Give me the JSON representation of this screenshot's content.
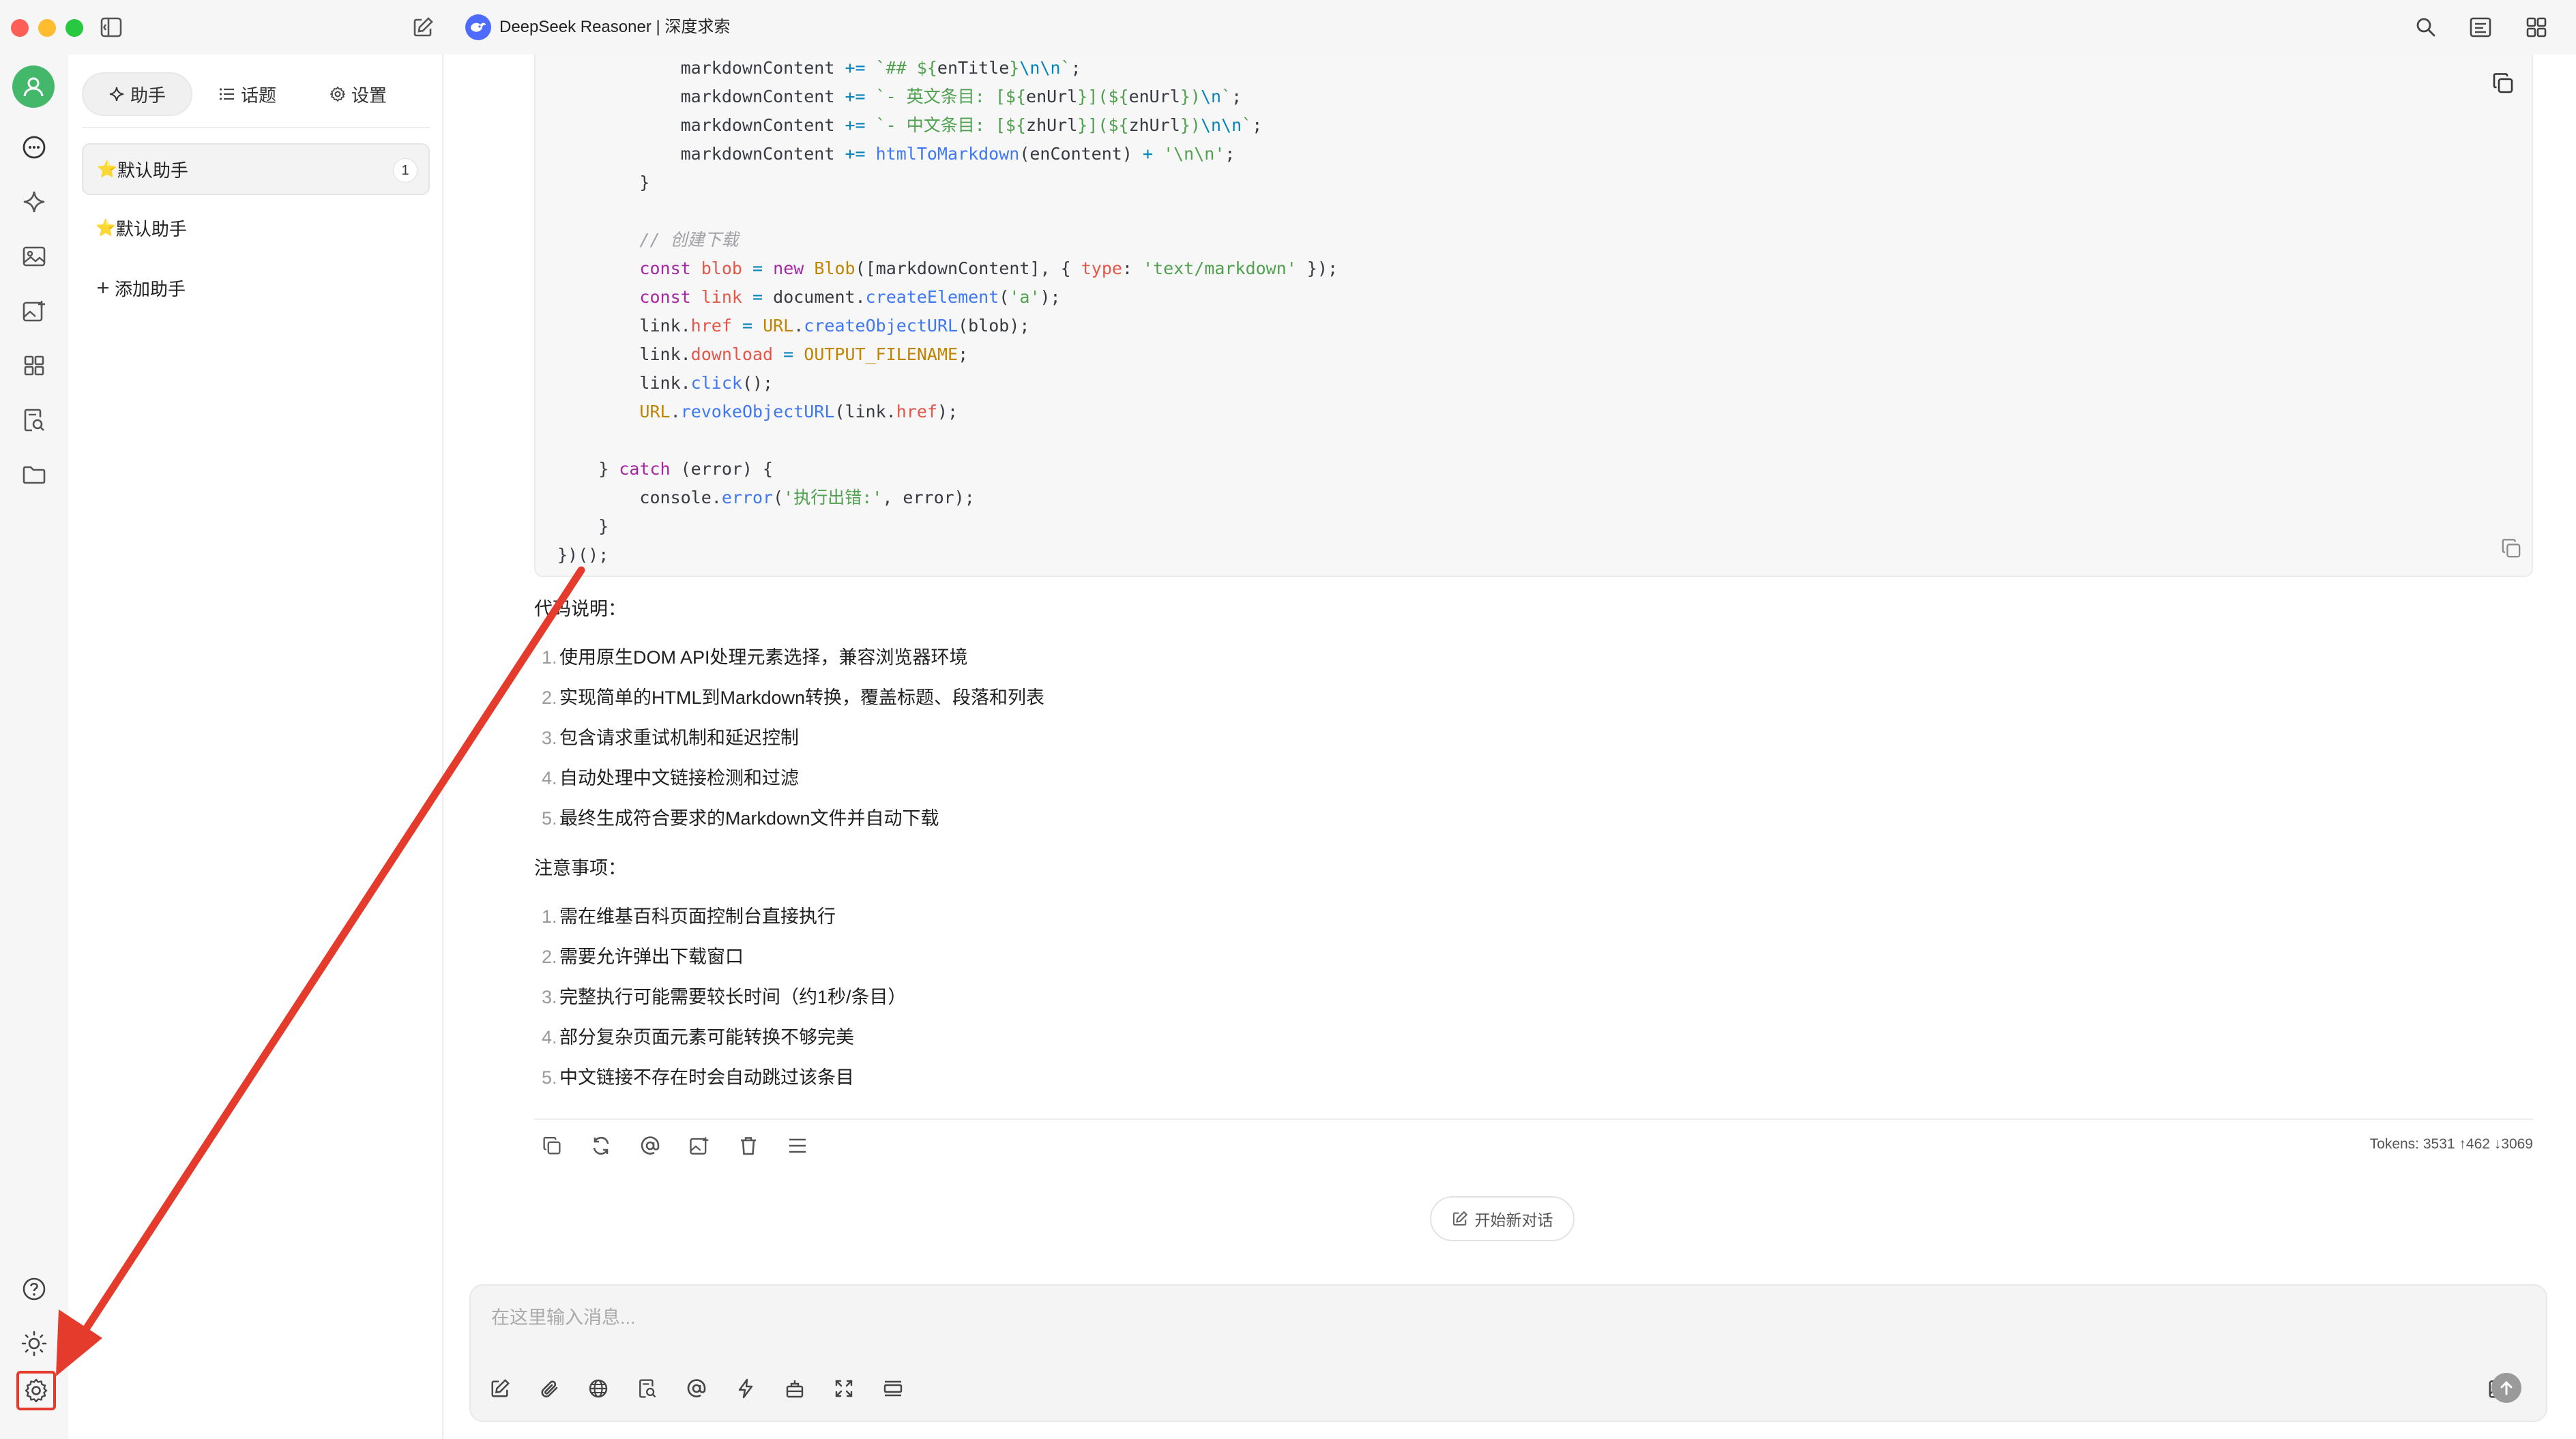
{
  "window": {
    "title": "DeepSeek Reasoner | 深度求索"
  },
  "sidebar": {
    "tabs": [
      {
        "label": "助手",
        "icon": "sparkle-icon"
      },
      {
        "label": "话题",
        "icon": "list-icon"
      },
      {
        "label": "设置",
        "icon": "gear-icon"
      }
    ],
    "assistants": [
      {
        "emoji": "⭐",
        "label": "默认助手",
        "count": "1"
      },
      {
        "emoji": "⭐",
        "label": "默认助手"
      }
    ],
    "add_label": "添加助手"
  },
  "code": {
    "lines": [
      "            markdownContent += `## ${enTitle}\\n\\n`;",
      "            markdownContent += `- 英文条目: [${enUrl}](${enUrl})\\n`;",
      "            markdownContent += `- 中文条目: [${zhUrl}](${zhUrl})\\n\\n`;",
      "            markdownContent += htmlToMarkdown(enContent) + '\\n\\n';",
      "        }",
      "",
      "        // 创建下载",
      "        const blob = new Blob([markdownContent], { type: 'text/markdown' });",
      "        const link = document.createElement('a');",
      "        link.href = URL.createObjectURL(blob);",
      "        link.download = OUTPUT_FILENAME;",
      "        link.click();",
      "        URL.revokeObjectURL(link.href);",
      "",
      "    } catch (error) {",
      "        console.error('执行出错:', error);",
      "    }",
      "})();"
    ]
  },
  "content": {
    "explain_heading": "代码说明：",
    "explain_items": [
      "使用原生DOM API处理元素选择，兼容浏览器环境",
      "实现简单的HTML到Markdown转换，覆盖标题、段落和列表",
      "包含请求重试机制和延迟控制",
      "自动处理中文链接检测和过滤",
      "最终生成符合要求的Markdown文件并自动下载"
    ],
    "notes_heading": "注意事项：",
    "notes_items": [
      "需在维基百科页面控制台直接执行",
      "需要允许弹出下载窗口",
      "完整执行可能需要较长时间（约1秒/条目）",
      "部分复杂页面元素可能转换不够完美",
      "中文链接不存在时会自动跳过该条目"
    ]
  },
  "message": {
    "tokens": "Tokens: 3531 ↑462 ↓3069"
  },
  "new_chat_label": "开始新对话",
  "composer": {
    "placeholder": "在这里输入消息..."
  },
  "colors": {
    "accent": "#4d6bfe",
    "avatar": "#43b86b",
    "annotation": "#e53b2c"
  }
}
